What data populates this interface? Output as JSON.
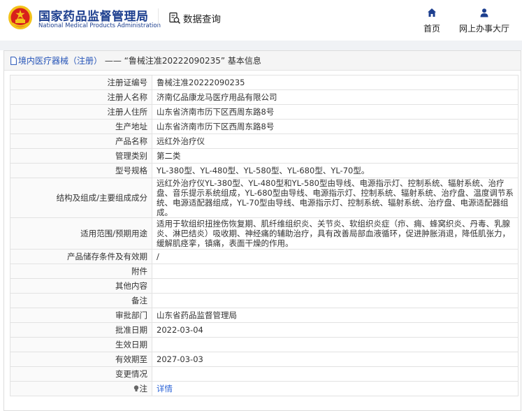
{
  "header": {
    "org_name_cn": "国家药品监督管理局",
    "org_name_en": "National Medical Products Administration",
    "query_label": "数据查询",
    "nav": [
      {
        "label": "首页",
        "icon": "home-icon"
      },
      {
        "label": "网上办事大厅",
        "icon": "user-icon"
      }
    ]
  },
  "breadcrumb": {
    "link": "境内医疗器械（注册）",
    "separator": " —— ",
    "title": "“鲁械注准20222090235” 基本信息"
  },
  "record": [
    {
      "label": "注册证编号",
      "value": "鲁械注准20222090235"
    },
    {
      "label": "注册人名称",
      "value": "济南亿品康龙马医疗用品有限公司"
    },
    {
      "label": "注册人住所",
      "value": "山东省济南市历下区西周东路8号"
    },
    {
      "label": "生产地址",
      "value": "山东省济南市历下区西周东路8号"
    },
    {
      "label": "产品名称",
      "value": "远红外治疗仪"
    },
    {
      "label": "管理类别",
      "value": "第二类"
    },
    {
      "label": "型号规格",
      "value": "YL-380型、YL-480型、YL-580型、YL-680型、YL-70型。"
    },
    {
      "label": "结构及组成/主要组成成分",
      "value": "远红外治疗仪YL-380型、YL-480型和YL-580型由导线、电源指示灯、控制系统、辐射系统、治疗盘、音乐提示系统组成，YL-680型由导线、电源指示灯、控制系统、辐射系统、治疗盘、温度调节系统、电源适配器组成，YL-70型由导线、电源指示灯、控制系统、辐射系统、治疗盘、电源适配器组成。"
    },
    {
      "label": "适用范围/预期用途",
      "value": "适用于软组织扭挫伤恢复期、肌纤维组织炎、关节炎、软组织炎症（疖、痈、蜂窝织炎、丹毒、乳腺炎、淋巴结炎）吸收期、神经痛的辅助治疗，具有改善局部血液循环，促进肿胀消退，降低肌张力，缓解肌痉挛，镇痛，表面干燥的作用。"
    },
    {
      "label": "产品储存条件及有效期",
      "value": "/"
    },
    {
      "label": "附件",
      "value": ""
    },
    {
      "label": "其他内容",
      "value": ""
    },
    {
      "label": "备注",
      "value": ""
    },
    {
      "label": "审批部门",
      "value": "山东省药品监督管理局"
    },
    {
      "label": "批准日期",
      "value": "2022-03-04"
    },
    {
      "label": "生效日期",
      "value": ""
    },
    {
      "label": "有效期至",
      "value": "2027-03-03"
    },
    {
      "label": "变更情况",
      "value": ""
    }
  ],
  "note": {
    "label": "注",
    "link": "详情"
  },
  "colors": {
    "brand_blue": "#1d3f8f",
    "link_blue": "#2b63d6",
    "emblem_red": "#d8201c",
    "emblem_gold": "#f3c21a"
  }
}
